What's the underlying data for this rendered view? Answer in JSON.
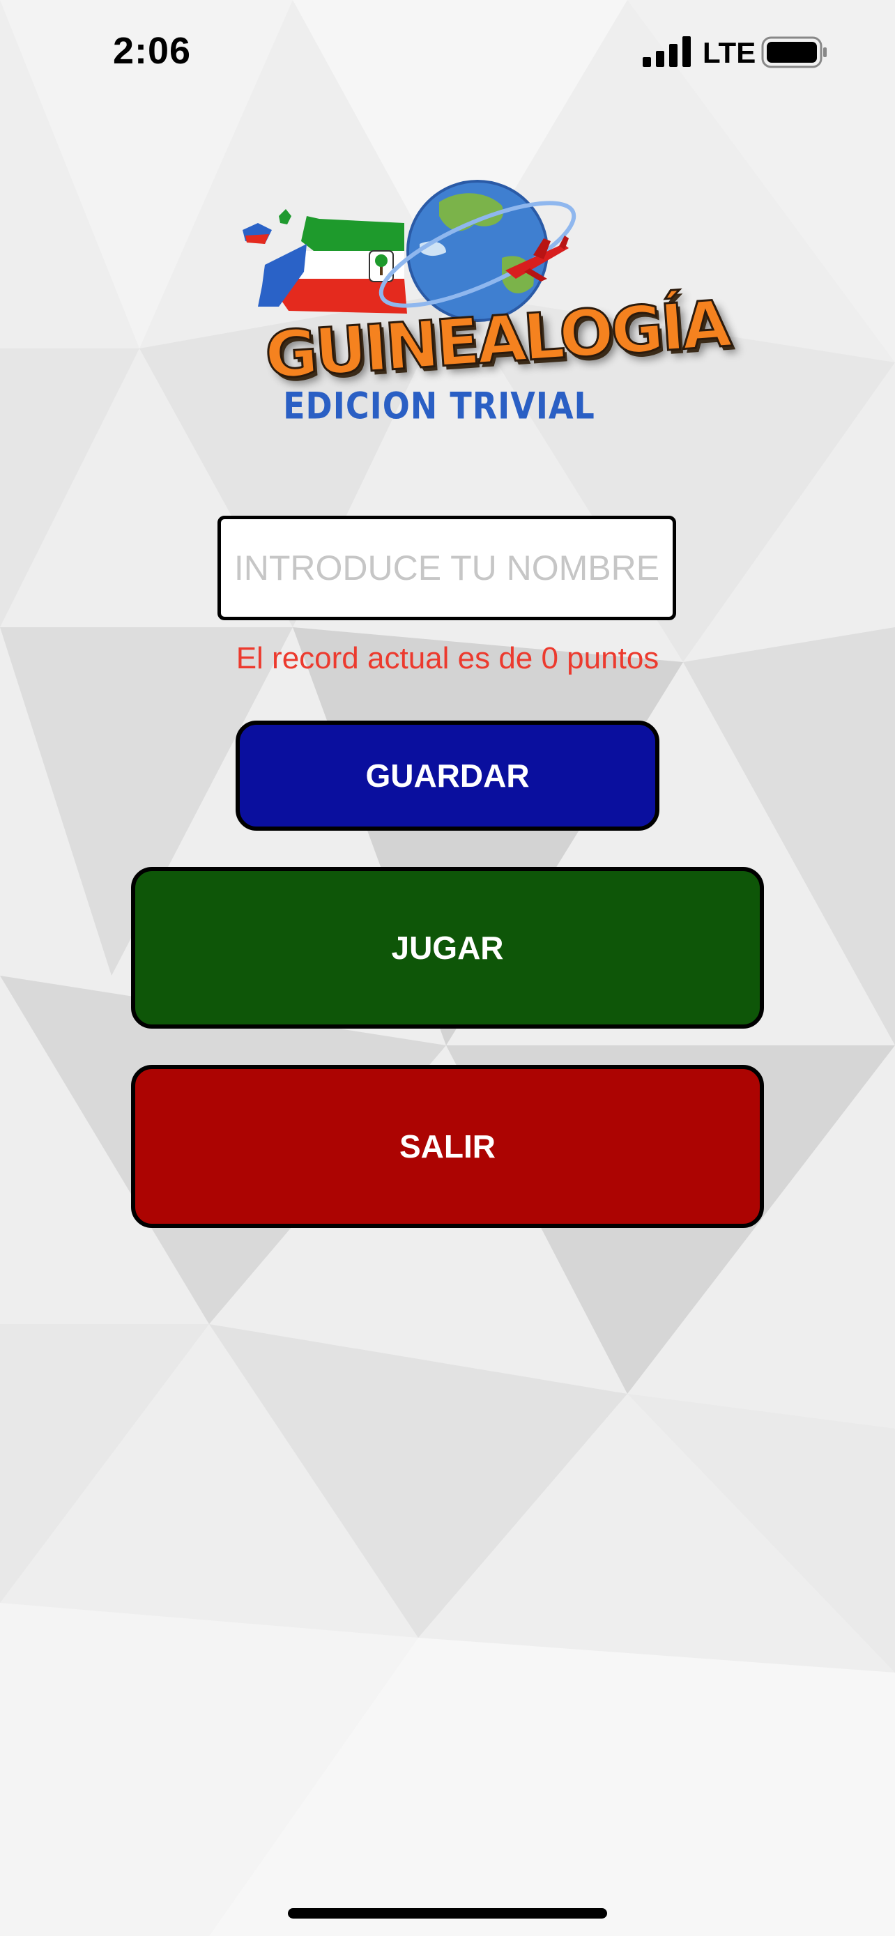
{
  "status_bar": {
    "time": "2:06",
    "network": "LTE"
  },
  "logo": {
    "title": "GUINEALOGÍA",
    "subtitle": "EDICION TRIVIAL"
  },
  "form": {
    "name_placeholder": "INTRODUCE TU NOMBRE",
    "name_value": "",
    "record_text": "El record actual es de 0 puntos"
  },
  "buttons": {
    "save_label": "GUARDAR",
    "play_label": "JUGAR",
    "exit_label": "SALIR"
  },
  "colors": {
    "save_button": "#0a0f9e",
    "play_button": "#0e5608",
    "exit_button": "#ac0402",
    "record_text": "#ec3a2e",
    "logo_title": "#f5821f",
    "logo_subtitle": "#2a5fc4"
  },
  "icons": [
    "cellular-signal-icon",
    "battery-icon",
    "equatorial-guinea-map-icon",
    "globe-icon",
    "airplane-icon"
  ]
}
